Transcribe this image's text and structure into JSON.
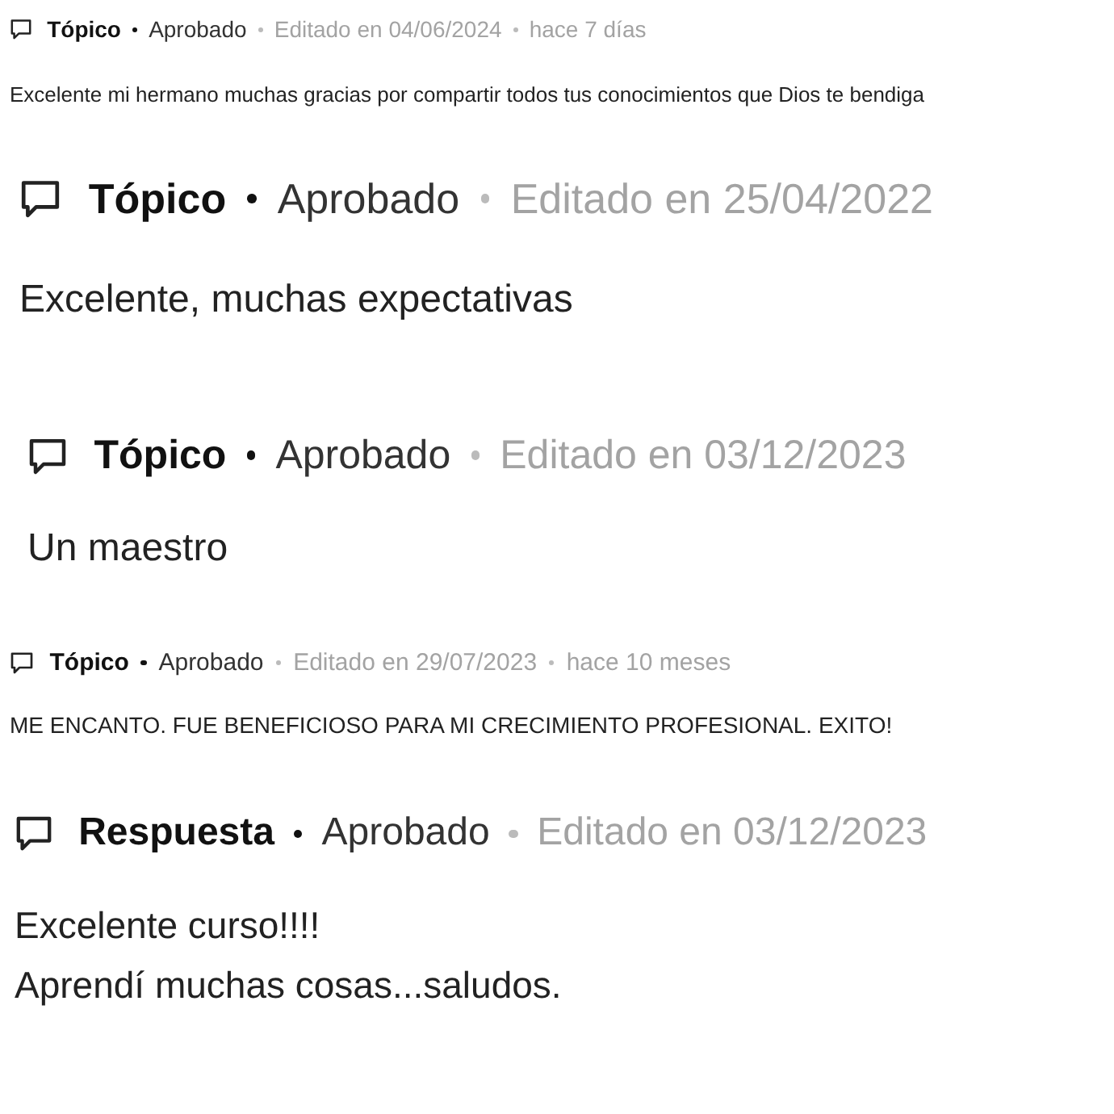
{
  "posts": [
    {
      "type": "Tópico",
      "status": "Aprobado",
      "edited": "Editado en 04/06/2024",
      "ago": "hace 7 días",
      "body": [
        "Excelente mi hermano muchas gracias por compartir todos tus conocimientos que Dios te bendiga"
      ]
    },
    {
      "type": "Tópico",
      "status": "Aprobado",
      "edited": "Editado en 25/04/2022",
      "body": [
        "Excelente, muchas expectativas"
      ]
    },
    {
      "type": "Tópico",
      "status": "Aprobado",
      "edited": "Editado en 03/12/2023",
      "body": [
        "Un maestro"
      ]
    },
    {
      "type": "Tópico",
      "status": "Aprobado",
      "edited": "Editado en 29/07/2023",
      "ago": "hace 10 meses",
      "body": [
        "ME ENCANTO. FUE BENEFICIOSO PARA MI CRECIMIENTO PROFESIONAL. EXITO!"
      ]
    },
    {
      "type": "Respuesta",
      "status": "Aprobado",
      "edited": "Editado en 03/12/2023",
      "body": [
        "Excelente curso!!!!",
        "Aprendí muchas cosas...saludos."
      ]
    }
  ]
}
